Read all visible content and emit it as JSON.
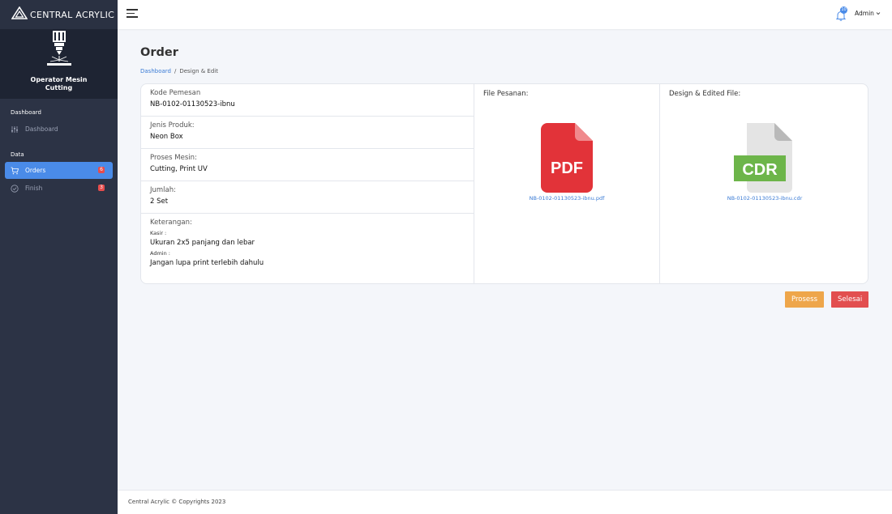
{
  "brand": {
    "name": "CENTRAL ACRYLIC"
  },
  "profile": {
    "name": "Operator Mesin Cutting"
  },
  "sidebar": {
    "section_dashboard": "Dashboard",
    "dashboard_item": "Dashboard",
    "section_data": "Data",
    "items": [
      {
        "label": "Orders",
        "badge": "6",
        "active": true
      },
      {
        "label": "Finish",
        "badge": "3",
        "active": false
      }
    ]
  },
  "topbar": {
    "notification_count": "10",
    "user": "Admin"
  },
  "page": {
    "title": "Order",
    "breadcrumb": {
      "home": "Dashboard",
      "separator": "/",
      "current": "Design & Edit"
    }
  },
  "order": {
    "kode_label": "Kode Pemesan",
    "kode_value": "NB-0102-01130523-ibnu",
    "jenis_label": "Jenis Produk:",
    "jenis_value": "Neon Box",
    "proses_label": "Proses Mesin:",
    "proses_value": "Cutting, Print UV",
    "jumlah_label": "Jumlah:",
    "jumlah_value": "2 Set",
    "keterangan_label": "Keterangan:",
    "kasir_label": "Kasir :",
    "kasir_value": "Ukuran 2x5 panjang dan lebar",
    "admin_label": "Admin :",
    "admin_value": "Jangan lupa print terlebih dahulu"
  },
  "files": {
    "pesanan_title": "File Pesanan:",
    "pesanan_icon_text": "PDF",
    "pesanan_file": "NB-0102-01130523-ibnu.pdf",
    "design_title": "Design & Edited File:",
    "design_icon_text": "CDR",
    "design_file": "NB-0102-01130523-ibnu.cdr"
  },
  "actions": {
    "proses": "Prosess",
    "selesai": "Selesai"
  },
  "footer": {
    "text": "Central Acrylic © Copyrights 2023"
  },
  "colors": {
    "sidebar_bg": "#2c3345",
    "accent": "#4a8be8",
    "badge": "#e74c4c",
    "pdf": "#e23339",
    "cdr": "#6db54a",
    "proses_btn": "#eea64a",
    "selesai_btn": "#e24f4f"
  },
  "icons": {
    "brand": "triangle-logo-icon",
    "profile": "laser-cutter-icon",
    "dashboard": "sliders-icon",
    "orders": "cart-icon",
    "finish": "check-circle-icon",
    "menu": "hamburger-menu-icon",
    "bell": "bell-icon",
    "user_dropdown": "chevron-down-icon"
  }
}
